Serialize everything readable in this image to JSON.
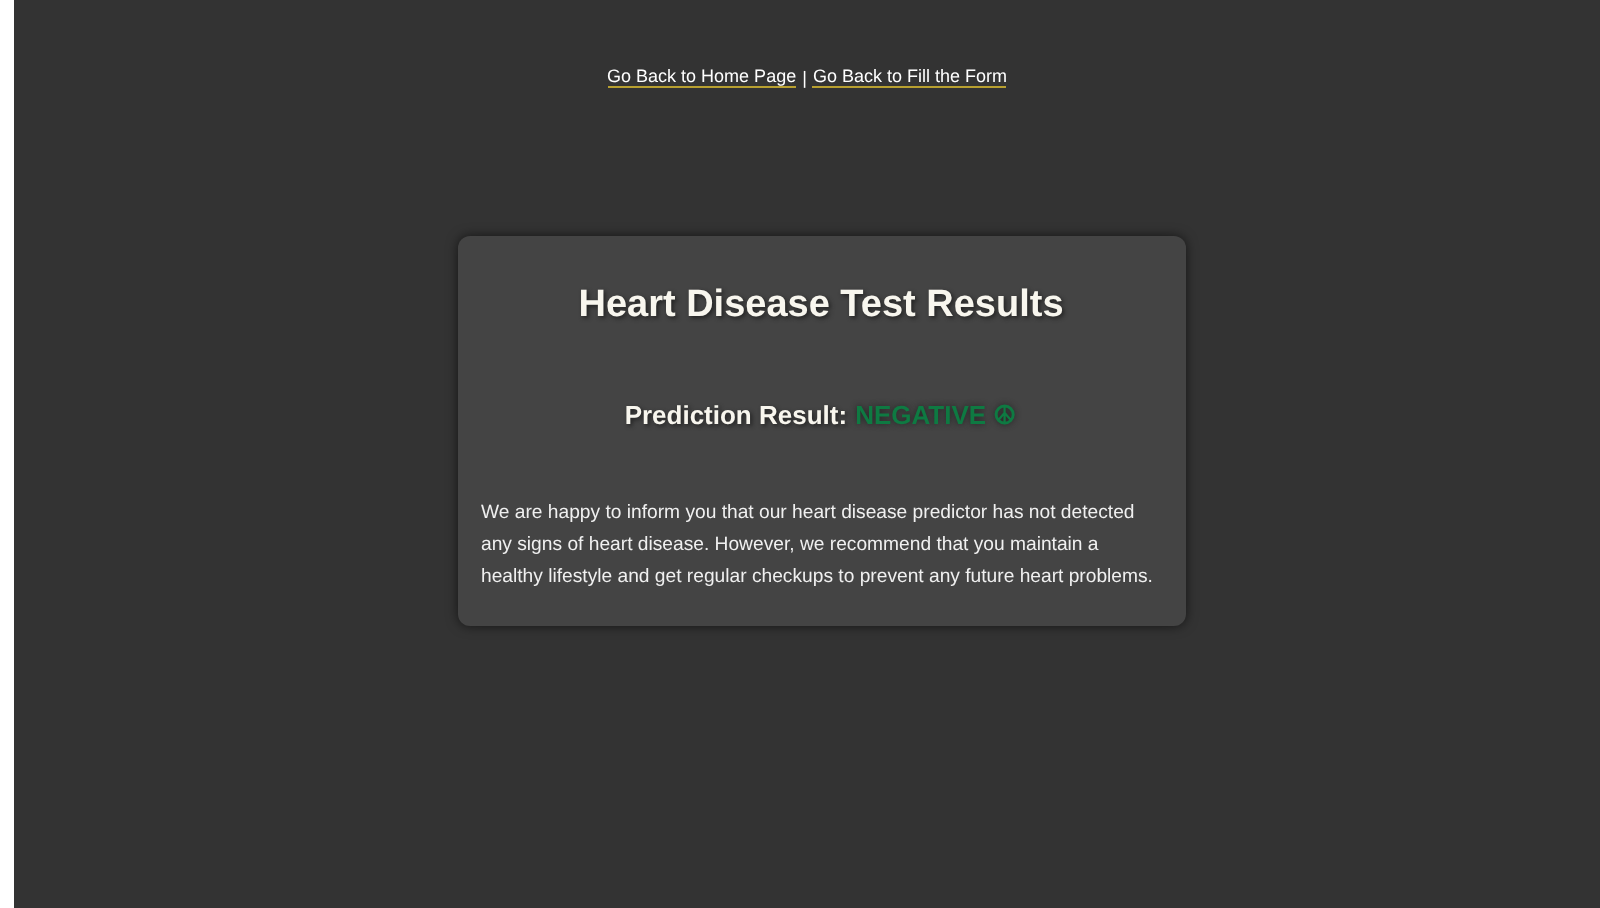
{
  "nav_links": [
    {
      "label": "Go Back to Home Page"
    },
    {
      "label": "Go Back to Fill the Form"
    }
  ],
  "nav_separator": "|",
  "card": {
    "title": "Heart Disease Test Results",
    "result": {
      "label": "Prediction Result:",
      "value": "NEGATIVE ☮",
      "kind": "negative"
    },
    "message": "We are happy to inform you that our heart disease predictor has not detected any signs of heart disease. However, we recommend that you maintain a healthy lifestyle and get regular checkups to prevent any future heart problems."
  }
}
